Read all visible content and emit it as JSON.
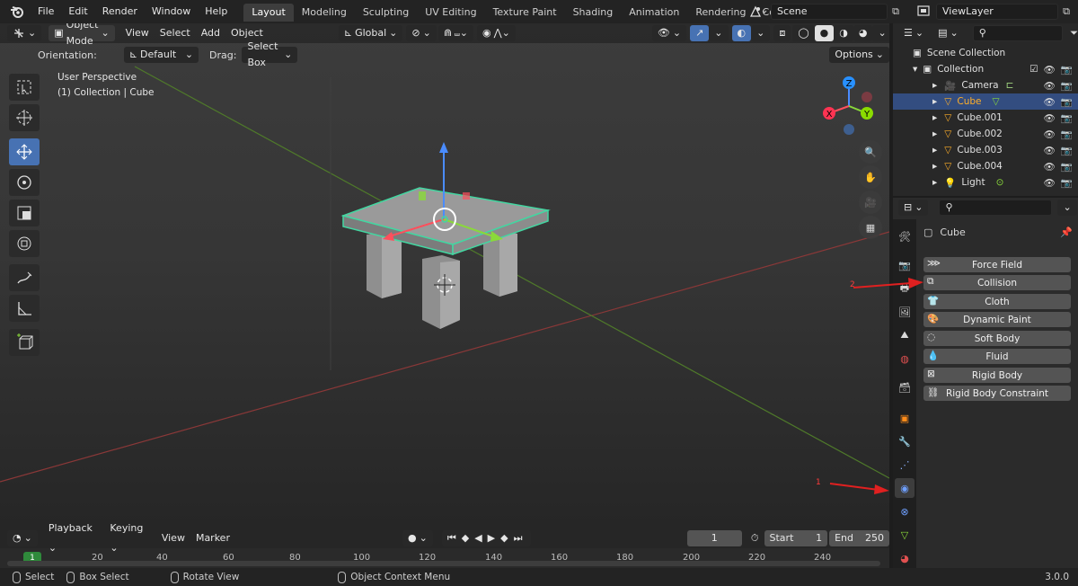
{
  "topbar": {
    "menu": [
      "File",
      "Edit",
      "Render",
      "Window",
      "Help"
    ],
    "workspaces": [
      "Layout",
      "Modeling",
      "Sculpting",
      "UV Editing",
      "Texture Paint",
      "Shading",
      "Animation",
      "Rendering",
      "Compositing"
    ],
    "active_workspace": "Layout",
    "scene": "Scene",
    "view_layer": "ViewLayer"
  },
  "viewport": {
    "mode": "Object Mode",
    "menus": [
      "View",
      "Select",
      "Add",
      "Object"
    ],
    "transform_orientation": "Global",
    "orientation_label": "Orientation:",
    "orientation_value": "Default",
    "drag_label": "Drag:",
    "drag_value": "Select Box",
    "options_label": "Options",
    "perspective": "User Perspective",
    "context": "(1) Collection | Cube",
    "gizmo": {
      "x": "X",
      "y": "Y",
      "z": "Z"
    }
  },
  "timeline": {
    "menus": [
      "Playback",
      "Keying",
      "View",
      "Marker"
    ],
    "current_frame": "1",
    "start_label": "Start",
    "start_value": "1",
    "end_label": "End",
    "end_value": "250",
    "ticks": [
      "1",
      "20",
      "40",
      "60",
      "80",
      "100",
      "120",
      "140",
      "160",
      "180",
      "200",
      "220",
      "240"
    ]
  },
  "statusbar": {
    "select": "Select",
    "box_select": "Box Select",
    "rotate": "Rotate View",
    "context_menu": "Object Context Menu",
    "version": "3.0.0"
  },
  "outliner": {
    "scene_collection": "Scene Collection",
    "collection": "Collection",
    "items": [
      {
        "name": "Camera",
        "type": "camera"
      },
      {
        "name": "Cube",
        "type": "mesh",
        "selected": true
      },
      {
        "name": "Cube.001",
        "type": "mesh"
      },
      {
        "name": "Cube.002",
        "type": "mesh"
      },
      {
        "name": "Cube.003",
        "type": "mesh"
      },
      {
        "name": "Cube.004",
        "type": "mesh"
      },
      {
        "name": "Light",
        "type": "light"
      }
    ]
  },
  "properties": {
    "object_name": "Cube",
    "physics_buttons": [
      "Force Field",
      "Collision",
      "Cloth",
      "Dynamic Paint",
      "Soft Body",
      "Fluid",
      "Rigid Body",
      "Rigid Body Constraint"
    ],
    "annotations": [
      "1",
      "2"
    ]
  },
  "colors": {
    "accent_blue": "#4772b3",
    "selection_orange": "#ffaf29",
    "outline_green": "#43d6a1",
    "annotation_red": "#e02020"
  }
}
